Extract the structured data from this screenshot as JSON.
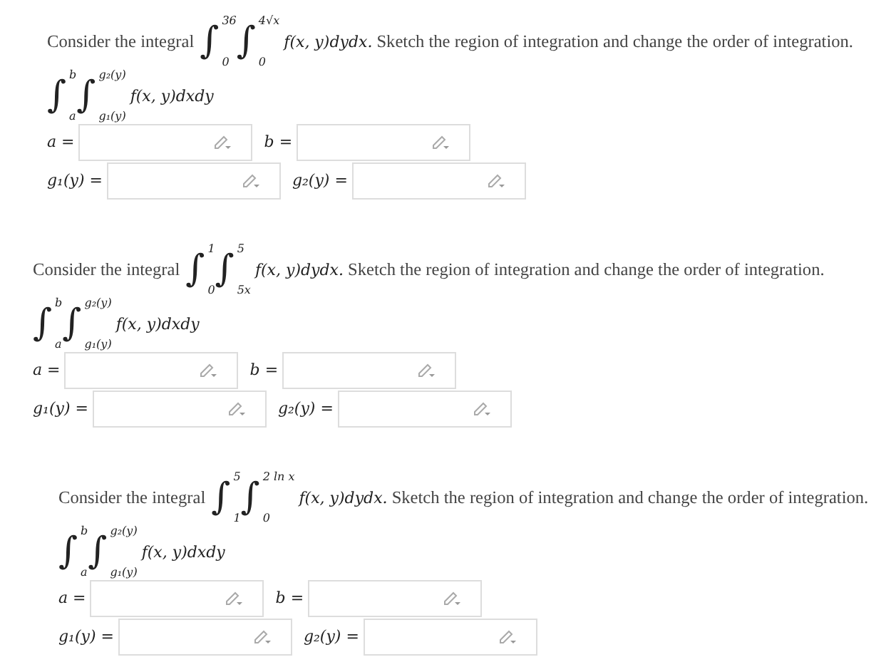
{
  "problems": [
    {
      "intro": "Consider the integral",
      "outer": {
        "sign": "∫",
        "lower": "0",
        "upper": "36"
      },
      "inner": {
        "sign": "∫",
        "lower": "0",
        "upper": "4√x"
      },
      "integrand": "f(x, y)dydx.",
      "rest": "Sketch the region of integration and change the order of integration.",
      "target": {
        "outer": {
          "sign": "∫",
          "lower": "a",
          "upper": "b"
        },
        "inner": {
          "sign": "∫",
          "lower": "g₁(y)",
          "upper": "g₂(y)"
        },
        "integrand": "f(x, y)dxdy"
      },
      "fields": [
        {
          "label": "a ="
        },
        {
          "label": "b ="
        },
        {
          "label": "g₁(y) ="
        },
        {
          "label": "g₂(y) ="
        }
      ]
    },
    {
      "intro": "Consider the integral",
      "outer": {
        "sign": "∫",
        "lower": "0",
        "upper": "1"
      },
      "inner": {
        "sign": "∫",
        "lower": "5x",
        "upper": "5"
      },
      "integrand": "f(x, y)dydx.",
      "rest": "Sketch the region of integration and change the order of integration.",
      "target": {
        "outer": {
          "sign": "∫",
          "lower": "a",
          "upper": "b"
        },
        "inner": {
          "sign": "∫",
          "lower": "g₁(y)",
          "upper": "g₂(y)"
        },
        "integrand": "f(x, y)dxdy"
      },
      "fields": [
        {
          "label": "a ="
        },
        {
          "label": "b ="
        },
        {
          "label": "g₁(y) ="
        },
        {
          "label": "g₂(y) ="
        }
      ]
    },
    {
      "intro": "Consider the integral",
      "outer": {
        "sign": "∫",
        "lower": "1",
        "upper": "5"
      },
      "inner": {
        "sign": "∫",
        "lower": "0",
        "upper": "2 ln x"
      },
      "integrand": "f(x, y)dydx.",
      "rest": "Sketch the region of integration and change the order of integration.",
      "target": {
        "outer": {
          "sign": "∫",
          "lower": "a",
          "upper": "b"
        },
        "inner": {
          "sign": "∫",
          "lower": "g₁(y)",
          "upper": "g₂(y)"
        },
        "integrand": "f(x, y)dxdy"
      },
      "fields": [
        {
          "label": "a ="
        },
        {
          "label": "b ="
        },
        {
          "label": "g₁(y) ="
        },
        {
          "label": "g₂(y) ="
        }
      ]
    }
  ]
}
